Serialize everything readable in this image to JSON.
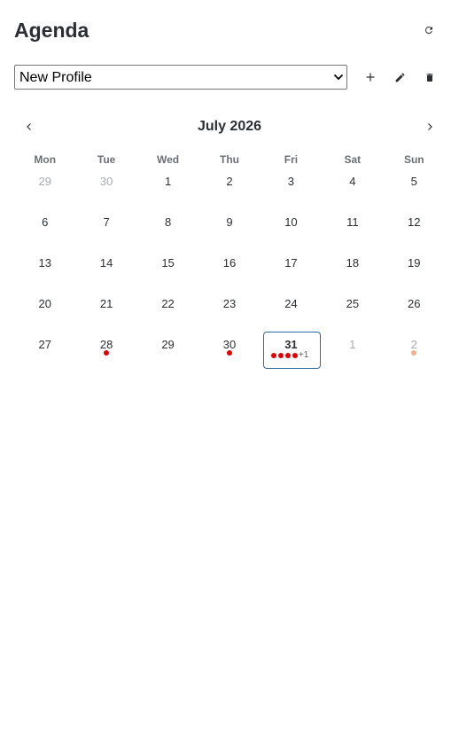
{
  "header": {
    "title": "Agenda"
  },
  "profile": {
    "selected": "New Profile"
  },
  "calendar": {
    "month_label": "July 2026",
    "weekdays": [
      "Mon",
      "Tue",
      "Wed",
      "Thu",
      "Fri",
      "Sat",
      "Sun"
    ],
    "days": [
      {
        "n": "29",
        "outside": true
      },
      {
        "n": "30",
        "outside": true
      },
      {
        "n": "1"
      },
      {
        "n": "2"
      },
      {
        "n": "3"
      },
      {
        "n": "4"
      },
      {
        "n": "5"
      },
      {
        "n": "6"
      },
      {
        "n": "7"
      },
      {
        "n": "8"
      },
      {
        "n": "9"
      },
      {
        "n": "10"
      },
      {
        "n": "11"
      },
      {
        "n": "12"
      },
      {
        "n": "13"
      },
      {
        "n": "14"
      },
      {
        "n": "15"
      },
      {
        "n": "16"
      },
      {
        "n": "17"
      },
      {
        "n": "18"
      },
      {
        "n": "19"
      },
      {
        "n": "20"
      },
      {
        "n": "21"
      },
      {
        "n": "22"
      },
      {
        "n": "23"
      },
      {
        "n": "24"
      },
      {
        "n": "25"
      },
      {
        "n": "26"
      },
      {
        "n": "27"
      },
      {
        "n": "28",
        "events": 1
      },
      {
        "n": "29"
      },
      {
        "n": "30",
        "events": 1
      },
      {
        "n": "31",
        "selected": true,
        "events": 4,
        "more": "+1"
      },
      {
        "n": "1",
        "outside": true
      },
      {
        "n": "2",
        "outside": true,
        "events": 1
      }
    ]
  },
  "colors": {
    "event_dot": "#e00000",
    "event_dot_outside": "#f2b08c",
    "selected_border": "#2d6aa3"
  },
  "icons": {
    "refresh": "refresh-icon",
    "add": "plus-icon",
    "edit": "pencil-icon",
    "delete": "trash-icon",
    "prev": "chevron-left-icon",
    "next": "chevron-right-icon"
  }
}
